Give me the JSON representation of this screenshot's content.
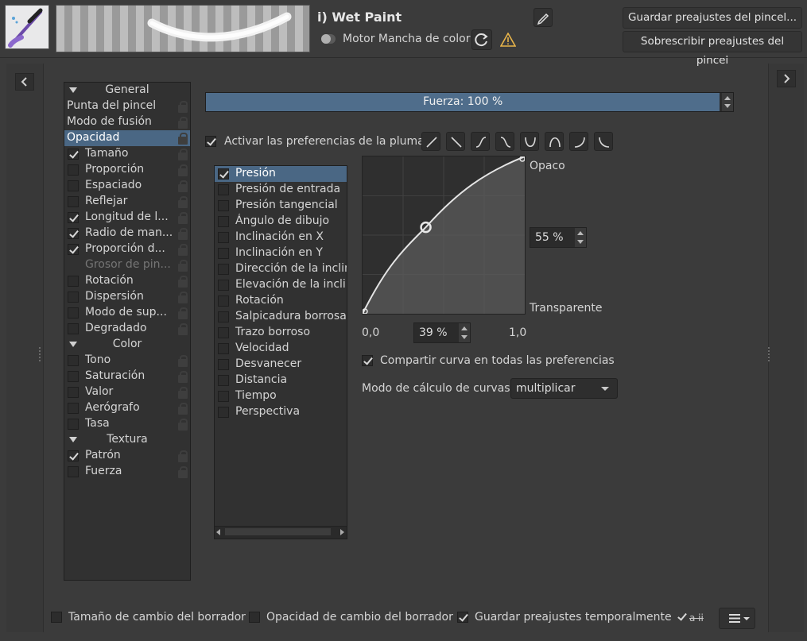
{
  "header": {
    "preset_name": "i) Wet Paint",
    "engine_label": "Motor Mancha de color",
    "save_preset_label": "Guardar preajustes del pincel...",
    "overwrite_preset_label": "Sobrescribir preajustes del pincel"
  },
  "fuerza_bar": {
    "label": "Fuerza: 100 %",
    "value_percent": 100
  },
  "pen_settings": {
    "label": "Activar las preferencias de la pluma"
  },
  "options_list": [
    {
      "label": "General",
      "kind": "header"
    },
    {
      "label": "Punta del pincel",
      "kind": "plain"
    },
    {
      "label": "Modo de fusión",
      "kind": "plain"
    },
    {
      "label": "Opacidad",
      "kind": "selected"
    },
    {
      "label": "Tamaño",
      "kind": "check",
      "checked": true
    },
    {
      "label": "Proporción",
      "kind": "check",
      "checked": false
    },
    {
      "label": "Espaciado",
      "kind": "check",
      "checked": false
    },
    {
      "label": "Reflejar",
      "kind": "check",
      "checked": false
    },
    {
      "label": "Longitud de l...",
      "kind": "check",
      "checked": true
    },
    {
      "label": "Radio de man...",
      "kind": "check",
      "checked": true
    },
    {
      "label": "Proporción d...",
      "kind": "check",
      "checked": true
    },
    {
      "label": "Grosor de pin...",
      "kind": "disabled"
    },
    {
      "label": "Rotación",
      "kind": "check",
      "checked": false
    },
    {
      "label": "Dispersión",
      "kind": "check",
      "checked": false
    },
    {
      "label": "Modo de sup...",
      "kind": "check",
      "checked": false
    },
    {
      "label": "Degradado",
      "kind": "check",
      "checked": false
    },
    {
      "label": "Color",
      "kind": "header"
    },
    {
      "label": "Tono",
      "kind": "check",
      "checked": false
    },
    {
      "label": "Saturación",
      "kind": "check",
      "checked": false
    },
    {
      "label": "Valor",
      "kind": "check",
      "checked": false
    },
    {
      "label": "Aerógrafo",
      "kind": "check",
      "checked": false
    },
    {
      "label": "Tasa",
      "kind": "check",
      "checked": false
    },
    {
      "label": "Textura",
      "kind": "header"
    },
    {
      "label": "Patrón",
      "kind": "check",
      "checked": true
    },
    {
      "label": "Fuerza",
      "kind": "check",
      "checked": false
    }
  ],
  "sensors": [
    {
      "label": "Presión",
      "checked": true
    },
    {
      "label": "Presión de entrada",
      "checked": false
    },
    {
      "label": "Presión tangencial",
      "checked": false
    },
    {
      "label": "Ángulo de dibujo",
      "checked": false
    },
    {
      "label": "Inclinación en X",
      "checked": false
    },
    {
      "label": "Inclinación en Y",
      "checked": false
    },
    {
      "label": "Dirección de la inclin",
      "checked": false
    },
    {
      "label": "Elevación de la inclin",
      "checked": false
    },
    {
      "label": "Rotación",
      "checked": false
    },
    {
      "label": "Salpicadura borrosa",
      "checked": false
    },
    {
      "label": "Trazo borroso",
      "checked": false
    },
    {
      "label": "Velocidad",
      "checked": false
    },
    {
      "label": "Desvanecer",
      "checked": false
    },
    {
      "label": "Distancia",
      "checked": false
    },
    {
      "label": "Tiempo",
      "checked": false
    },
    {
      "label": "Perspectiva",
      "checked": false
    }
  ],
  "curve": {
    "top_label": "Opaco",
    "bottom_label": "Transparente",
    "x_min_label": "0,0",
    "x_max_label": "1,0",
    "y_value": "55 %",
    "x_value": "39 %",
    "points": [
      [
        0,
        0
      ],
      [
        0.39,
        0.55
      ],
      [
        1,
        1
      ]
    ],
    "share_label": "Compartir curva en todas las preferencias",
    "mode_label": "Modo de cálculo de curvas:",
    "mode_value": "multiplicar"
  },
  "curve_presets": [
    "linear-up-icon",
    "linear-down-icon",
    "s-curve-icon",
    "reverse-s-curve-icon",
    "u-curve-icon",
    "arch-curve-icon",
    "j-curve-icon",
    "l-curve-icon"
  ],
  "footer": {
    "eraser_size_label": "Tamaño de cambio del borrador",
    "eraser_opacity_label": "Opacidad de cambio del borrador",
    "temp_save_label": "Guardar preajustes temporalmente",
    "ai_label": "a ii"
  },
  "colors": {
    "accent": "#4f6d8b",
    "selection": "#4a6784",
    "background": "#3b3b3b",
    "warning": "#e8b44a"
  }
}
